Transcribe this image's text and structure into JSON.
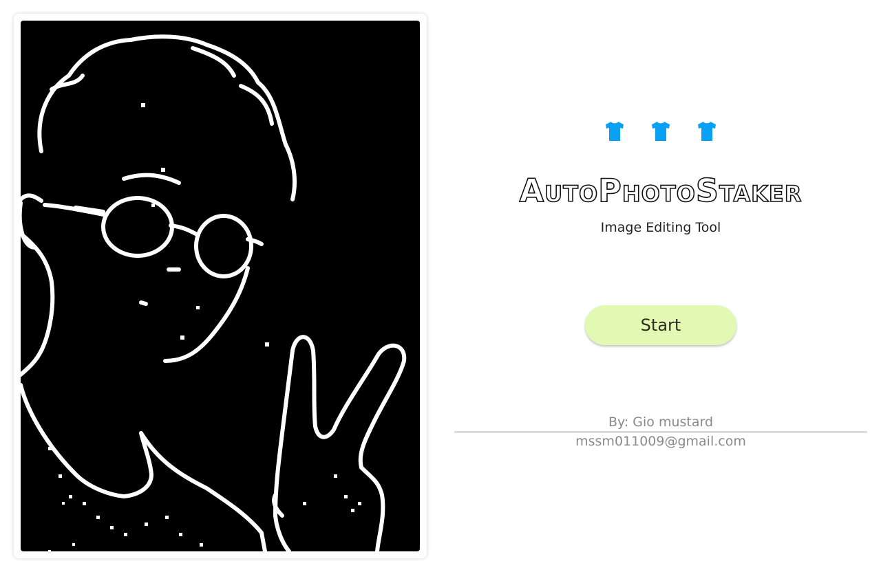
{
  "hero_image": {
    "alt": "Edge-detected line drawing of a person wearing glasses making a peace sign"
  },
  "header": {
    "icons": [
      "tshirt-icon",
      "tshirt-icon",
      "tshirt-icon"
    ],
    "icon_color": "#0aa1f5",
    "title": "AutoPhotoStaker",
    "subtitle": "Image Editing Tool"
  },
  "actions": {
    "start_label": "Start",
    "start_color": "#e2f9b3"
  },
  "credits": {
    "author": "By: Gio mustard",
    "email": "mssm011009@gmail.com"
  }
}
